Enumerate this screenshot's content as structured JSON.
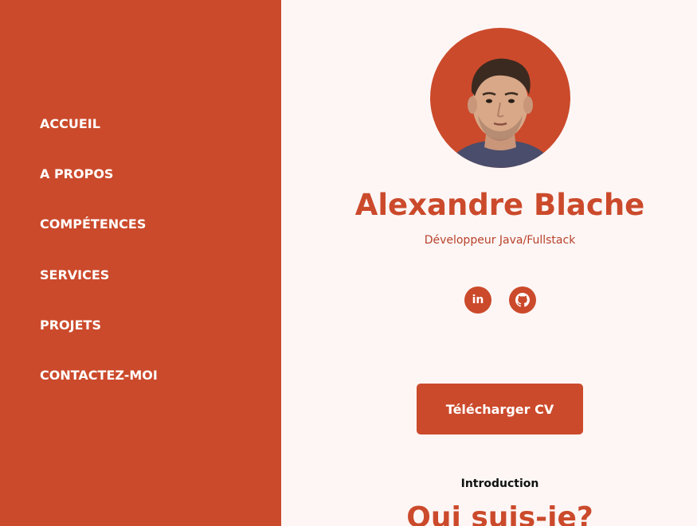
{
  "theme": {
    "accent": "#cb4a2b",
    "background": "#fdf6f5",
    "nav_text": "#ffffff"
  },
  "nav": {
    "items": [
      {
        "label": "ACCUEIL"
      },
      {
        "label": "A PROPOS"
      },
      {
        "label": "COMPÉTENCES"
      },
      {
        "label": "SERVICES"
      },
      {
        "label": "PROJETS"
      },
      {
        "label": "CONTACTEZ-MOI"
      }
    ]
  },
  "profile": {
    "name": "Alexandre Blache",
    "role": "Développeur Java/Fullstack"
  },
  "social": {
    "linkedin_label": "in",
    "linkedin_icon": "linkedin-icon",
    "github_icon": "github-icon"
  },
  "cta": {
    "download_cv": "Télécharger CV"
  },
  "section": {
    "eyebrow": "Introduction",
    "title": "Qui suis-je?"
  }
}
